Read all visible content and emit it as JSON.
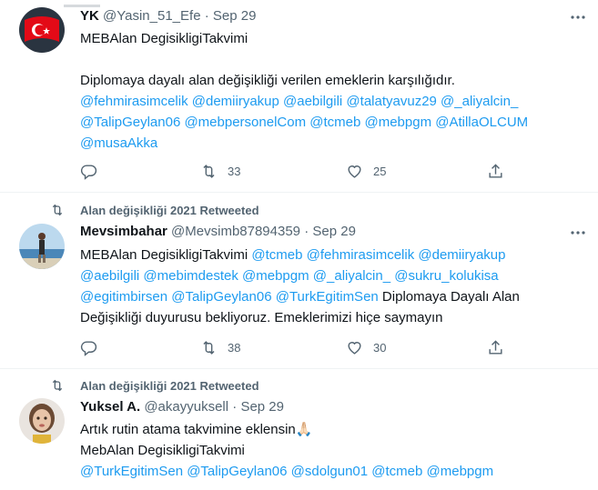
{
  "tweets": [
    {
      "name": "YK",
      "handle": "@Yasin_51_Efe",
      "separator": "·",
      "date": "Sep 29",
      "lines": [
        [
          {
            "t": "MEBAlan DegisikligiTakvimi",
            "m": false
          }
        ],
        [],
        [
          {
            "t": "Diplomaya dayalı alan değişikliği verilen emeklerin karşılığıdır.",
            "m": false
          }
        ],
        [
          {
            "t": "@fehmirasimcelik @demiiryakup @aebilgili @talatyavuz29 @_aliyalcin_",
            "m": true
          }
        ],
        [
          {
            "t": "@TalipGeylan06 @mebpersonelCom @tcmeb @mebpgm @AtillaOLCUM",
            "m": true
          }
        ],
        [
          {
            "t": "@musaAkka",
            "m": true
          }
        ]
      ],
      "retweets": "33",
      "likes": "25"
    },
    {
      "retweeted_by": "Alan değişikliği 2021 Retweeted",
      "name": "Mevsimbahar",
      "handle": "@Mevsimb87894359",
      "separator": "·",
      "date": "Sep 29",
      "lines": [
        [
          {
            "t": "MEBAlan DegisikligiTakvimi ",
            "m": false
          },
          {
            "t": "@tcmeb @fehmirasimcelik @demiiryakup",
            "m": true
          }
        ],
        [
          {
            "t": "@aebilgili @mebimdestek @mebpgm @_aliyalcin_ @sukru_kolukisa",
            "m": true
          }
        ],
        [
          {
            "t": "@egitimbirsen @TalipGeylan06 @TurkEgitimSen",
            "m": true
          },
          {
            "t": " Diplomaya Dayalı Alan",
            "m": false
          }
        ],
        [
          {
            "t": "Değişikliği duyurusu bekliyoruz. Emeklerimizi hiçe saymayın",
            "m": false
          }
        ]
      ],
      "retweets": "38",
      "likes": "30"
    },
    {
      "retweeted_by": "Alan değişikliği 2021 Retweeted",
      "name": "Yuksel A.",
      "handle": "@akayyuksell",
      "separator": "·",
      "date": "Sep 29",
      "lines": [
        [
          {
            "t": "Artık rutin atama takvimine eklensin🙏🏻",
            "m": false
          }
        ],
        [
          {
            "t": "MebAlan DegisikligiTakvimi",
            "m": false
          }
        ],
        [
          {
            "t": "@TurkEgitimSen @TalipGeylan06 @sdolgun01 @tcmeb @mebpgm",
            "m": true
          }
        ]
      ]
    }
  ]
}
